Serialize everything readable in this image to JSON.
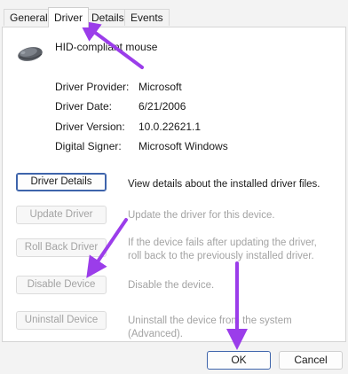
{
  "tabs": [
    {
      "label": "General"
    },
    {
      "label": "Driver"
    },
    {
      "label": "Details"
    },
    {
      "label": "Events"
    }
  ],
  "device": {
    "name": "HID-compliant mouse",
    "icon": "mouse-icon"
  },
  "properties": [
    {
      "label": "Driver Provider:",
      "value": "Microsoft"
    },
    {
      "label": "Driver Date:",
      "value": "6/21/2006"
    },
    {
      "label": "Driver Version:",
      "value": "10.0.22621.1"
    },
    {
      "label": "Digital Signer:",
      "value": "Microsoft Windows"
    }
  ],
  "actions": [
    {
      "button": "Driver Details",
      "description": "View details about the installed driver files.",
      "enabled": true
    },
    {
      "button": "Update Driver",
      "description": "Update the driver for this device.",
      "enabled": false
    },
    {
      "button": "Roll Back Driver",
      "description": "If the device fails after updating the driver, roll back to the previously installed driver.",
      "enabled": false
    },
    {
      "button": "Disable Device",
      "description": "Disable the device.",
      "enabled": false
    },
    {
      "button": "Uninstall Device",
      "description": "Uninstall the device from the system (Advanced).",
      "enabled": false
    }
  ],
  "footer": {
    "ok_label": "OK",
    "cancel_label": "Cancel"
  },
  "colors": {
    "annotation_arrow": "#9b3dea",
    "focus_border": "#3e64ab",
    "disabled_text": "#a3a3a3"
  }
}
